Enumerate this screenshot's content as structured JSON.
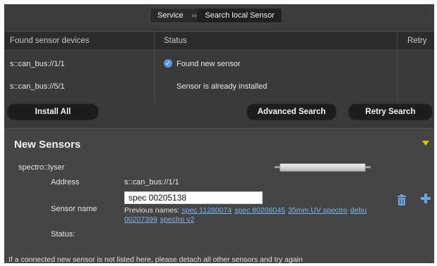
{
  "breadcrumb": {
    "items": [
      "Service",
      "Search local Sensor"
    ],
    "separator": "››"
  },
  "table": {
    "columns": [
      "Found sensor devices",
      "Status",
      "Retry"
    ],
    "rows": [
      {
        "device": "s::can_bus://1/1",
        "status": "Found new sensor",
        "status_icon": "check-icon"
      },
      {
        "device": "s::can_bus://5/1",
        "status": "Sensor is already installed",
        "status_icon": ""
      }
    ]
  },
  "buttons": {
    "install_all": "Install All",
    "advanced_search": "Advanced Search",
    "retry_search": "Retry Search"
  },
  "new_sensors": {
    "title": "New Sensors",
    "sensor_type": "spectro::lyser",
    "address_label": "Address",
    "address_value": "s::can_bus://1/1",
    "sensor_name_label": "Sensor name",
    "sensor_name_value": "spec 00205138",
    "previous_names_label": "Previous names:",
    "previous_names": [
      "spec 11280074",
      "spec 80208045",
      "35mm UV spectro",
      "debu 00207399",
      "spectro v2"
    ],
    "status_label": "Status:"
  },
  "footer_note": "If a connected new sensor is not listed here, please detach all other sensors and try again",
  "colors": {
    "background": "#3a3a3a",
    "panel": "#454545",
    "accent_link": "#7fb3ee",
    "accent_icon": "#5e97d8",
    "expand_triangle": "#e7c400"
  }
}
